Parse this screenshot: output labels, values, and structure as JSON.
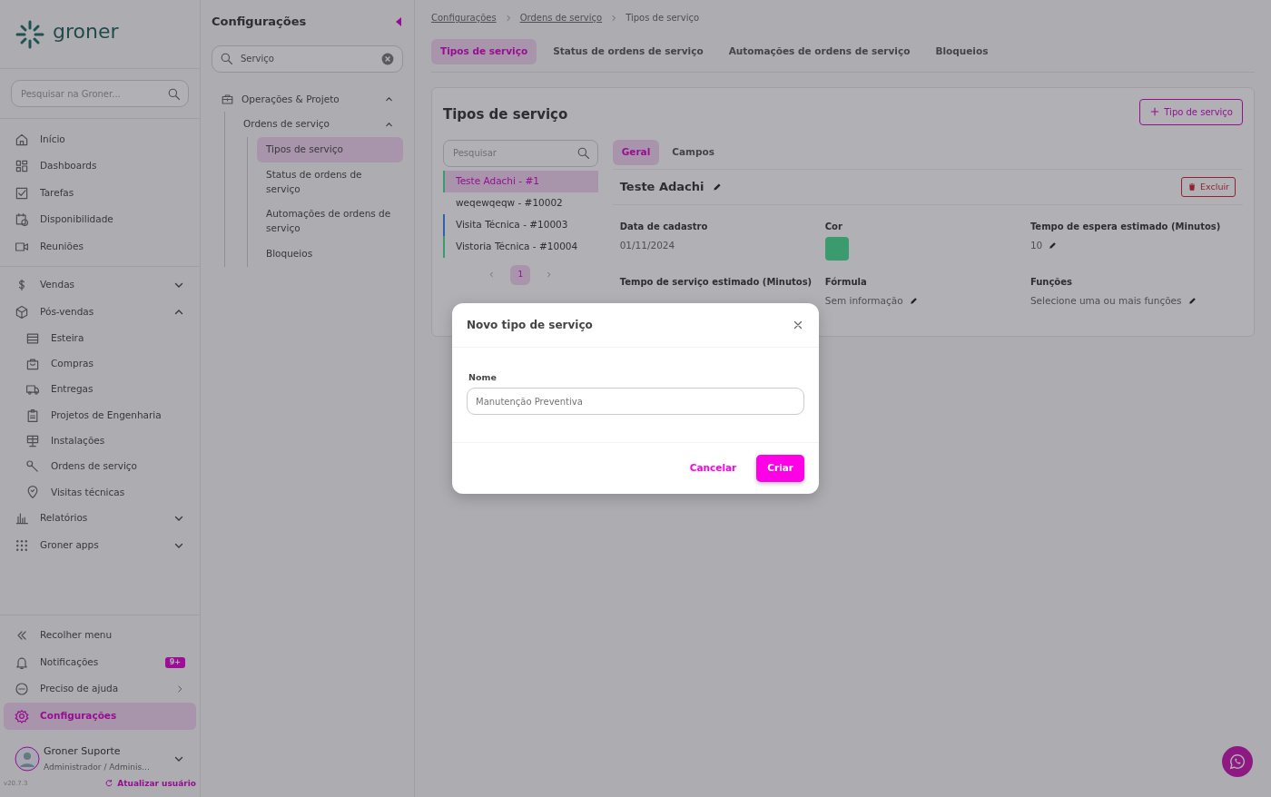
{
  "brand": {
    "name": "groner"
  },
  "global_search": {
    "placeholder": "Pesquisar na Groner..."
  },
  "nav": [
    {
      "label": "Início"
    },
    {
      "label": "Dashboards"
    },
    {
      "label": "Tarefas"
    },
    {
      "label": "Disponibilidade"
    },
    {
      "label": "Reuniões"
    }
  ],
  "nav_groups": [
    {
      "label": "Vendas",
      "expanded": false
    },
    {
      "label": "Pós-vendas",
      "expanded": true,
      "children": [
        {
          "label": "Esteira"
        },
        {
          "label": "Compras"
        },
        {
          "label": "Entregas"
        },
        {
          "label": "Projetos de Engenharia"
        },
        {
          "label": "Instalações"
        },
        {
          "label": "Ordens de serviço"
        },
        {
          "label": "Visitas técnicas"
        }
      ]
    },
    {
      "label": "Relatórios",
      "expanded": false
    },
    {
      "label": "Groner apps",
      "expanded": false
    }
  ],
  "footer_nav": [
    {
      "label": "Recolher menu",
      "selected": false
    },
    {
      "label": "Notificações",
      "badge": "9+",
      "selected": false
    },
    {
      "label": "Preciso de ajuda",
      "selected": false
    },
    {
      "label": "Configurações",
      "selected": true
    }
  ],
  "user": {
    "name": "Groner Suporte",
    "role": "Administrador / Adminis...",
    "version": "v20.7.3",
    "refresh_link": "Atualizar usuário"
  },
  "settings": {
    "title": "Configurações",
    "search": {
      "value": "Serviço"
    },
    "tree": [
      {
        "label": "Operações & Projeto",
        "expanded": true,
        "children": [
          {
            "label": "Ordens de serviço",
            "expanded": true,
            "children": [
              {
                "label": "Tipos de serviço",
                "selected": true
              },
              {
                "label": "Status de ordens de serviço",
                "selected": false
              },
              {
                "label": "Automações de ordens de serviço",
                "selected": false
              },
              {
                "label": "Bloqueios",
                "selected": false
              }
            ]
          }
        ]
      }
    ]
  },
  "breadcrumb": [
    "Configurações",
    "Ordens de serviço",
    "Tipos de serviço"
  ],
  "tabs": [
    {
      "label": "Tipos de serviço",
      "selected": true
    },
    {
      "label": "Status de ordens de serviço",
      "selected": false
    },
    {
      "label": "Automações de ordens de serviço",
      "selected": false
    },
    {
      "label": "Bloqueios",
      "selected": false
    }
  ],
  "panel": {
    "title": "Tipos de serviço",
    "add_button": "Tipo de serviço",
    "search": {
      "placeholder": "Pesquisar"
    },
    "items": [
      {
        "label": "Teste Adachi - #1",
        "selected": true,
        "color": "#3a9b6e"
      },
      {
        "label": "weqewqeqw - #10002",
        "selected": false
      },
      {
        "label": "Visita Técnica - #10003",
        "selected": false,
        "color": "#3060b0"
      },
      {
        "label": "Vistoria Técnica - #10004",
        "selected": false,
        "color": "#3a9b6e"
      }
    ],
    "pages": [
      {
        "label": "1",
        "selected": true
      }
    ],
    "detail_tabs": [
      {
        "label": "Geral",
        "selected": true
      },
      {
        "label": "Campos",
        "selected": false
      }
    ],
    "detail": {
      "title": "Teste Adachi",
      "delete_button": "Excluir",
      "fields": [
        {
          "label": "Data de cadastro",
          "value": "01/11/2024",
          "kind": "text"
        },
        {
          "label": "Cor",
          "kind": "color",
          "color": "#3a9b6e"
        },
        {
          "label": "Tempo de espera estimado (Minutos)",
          "value": "10",
          "kind": "editable"
        },
        {
          "label": "Tempo de serviço estimado (Minutos)",
          "kind": "covered"
        },
        {
          "label": "Fórmula",
          "value": "Sem informação",
          "kind": "editable"
        },
        {
          "label": "Funções",
          "value": "Selecione uma ou mais funções",
          "kind": "editable"
        }
      ]
    }
  },
  "modal": {
    "title": "Novo tipo de serviço",
    "field_label": "Nome",
    "placeholder": "Manutenção Preventiva",
    "cancel": "Cancelar",
    "confirm": "Criar"
  }
}
